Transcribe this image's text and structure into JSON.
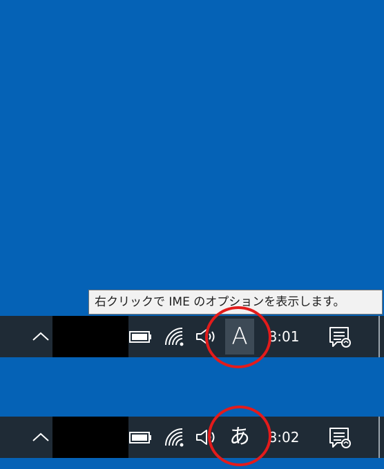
{
  "tooltip": {
    "text": "右クリックで IME のオプションを表示します。"
  },
  "taskbar_top": {
    "ime_mode": "A",
    "time": "8:01",
    "icons": [
      "chevron-up-icon",
      "battery-icon",
      "wifi-icon",
      "volume-icon",
      "notification-icon"
    ]
  },
  "taskbar_bottom": {
    "ime_mode": "あ",
    "time": "8:02",
    "icons": [
      "chevron-up-icon",
      "battery-icon",
      "wifi-icon",
      "volume-icon",
      "notification-icon"
    ]
  },
  "colors": {
    "desktop": "#0562b6",
    "taskbar": "#1f2b36",
    "highlight_circle": "#e31b1b",
    "tooltip_bg": "#f2f2f2"
  }
}
